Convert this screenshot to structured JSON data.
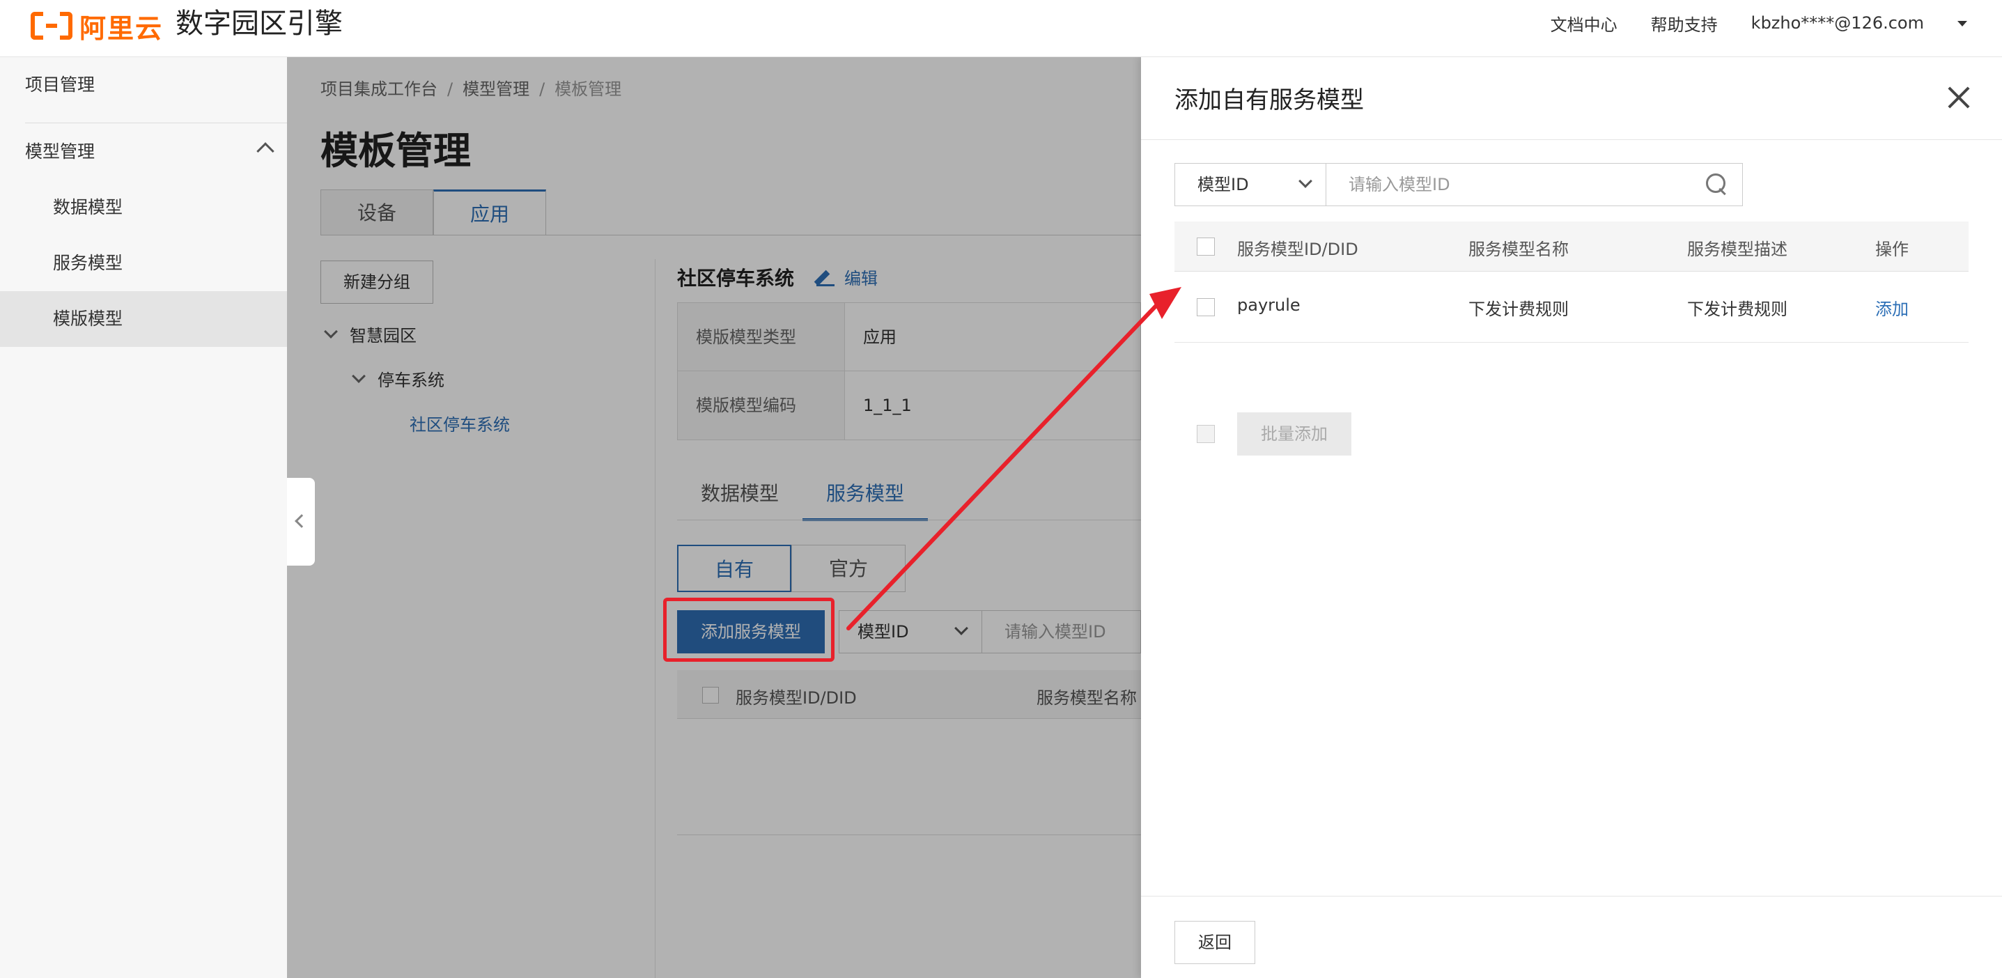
{
  "brand": {
    "logo_text": "阿里云",
    "product": "数字园区引擎",
    "accent": "#ff6a00"
  },
  "top_links": {
    "docs": "文档中心",
    "help": "帮助支持",
    "account": "kbzho****@126.com"
  },
  "sidebar": {
    "project_mgmt": "项目管理",
    "model_mgmt": "模型管理",
    "items": [
      {
        "label": "数据模型"
      },
      {
        "label": "服务模型"
      },
      {
        "label": "模版模型"
      }
    ]
  },
  "breadcrumb": [
    "项目集成工作台",
    "模型管理",
    "模板管理"
  ],
  "page_title": "模板管理",
  "top_tabs": [
    "设备",
    "应用"
  ],
  "new_group": "新建分组",
  "tree": {
    "root": "智慧园区",
    "child": "停车系统",
    "leaf": "社区停车系统"
  },
  "detail": {
    "title": "社区停车系统",
    "edit": "编辑",
    "rows": [
      {
        "label": "模版模型类型",
        "value": "应用"
      },
      {
        "label": "模版模型编码",
        "value": "1_1_1"
      }
    ]
  },
  "model_tabs": [
    "数据模型",
    "服务模型"
  ],
  "segment": [
    "自有",
    "官方"
  ],
  "add_service_btn": "添加服务模型",
  "filter": {
    "select": "模型ID",
    "placeholder": "请输入模型ID"
  },
  "list_headers": [
    "服务模型ID/DID",
    "服务模型名称"
  ],
  "drawer": {
    "title": "添加自有服务模型",
    "filter_select": "模型ID",
    "filter_placeholder": "请输入模型ID",
    "headers": [
      "服务模型ID/DID",
      "服务模型名称",
      "服务模型描述",
      "操作"
    ],
    "rows": [
      {
        "id": "payrule",
        "name": "下发计费规则",
        "desc": "下发计费规则",
        "action": "添加"
      }
    ],
    "batch_add": "批量添加",
    "back": "返回"
  },
  "colors": {
    "primary": "#2f6db3",
    "highlight": "#e8212b"
  }
}
